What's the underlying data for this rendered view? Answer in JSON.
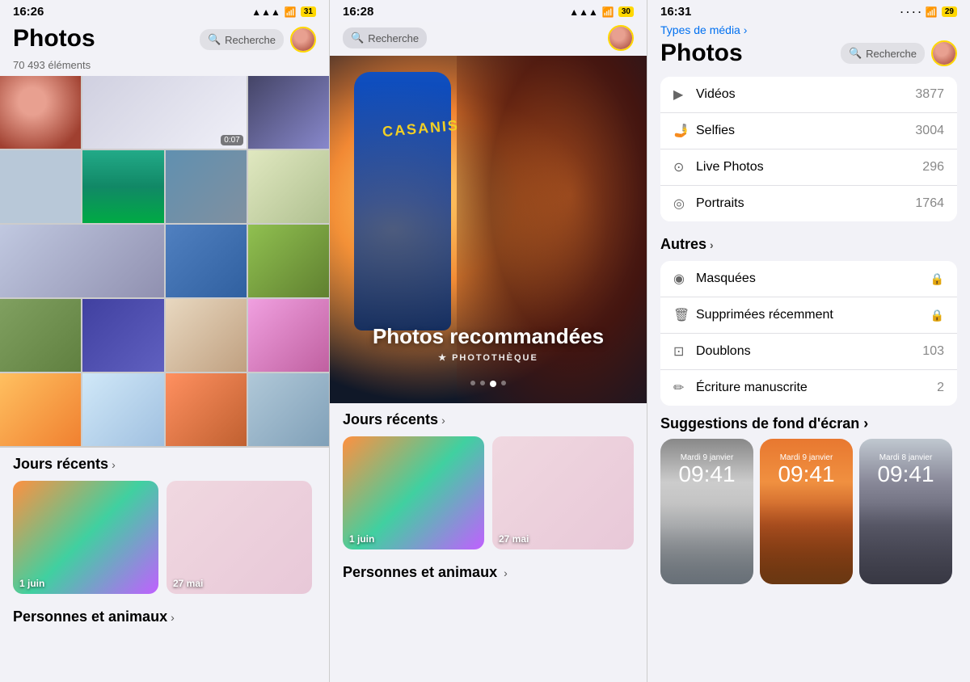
{
  "panel1": {
    "statusBar": {
      "time": "16:26",
      "signal": "▲▲▲",
      "wifi": "wifi",
      "batteryLabel": "31"
    },
    "header": {
      "title": "Photos",
      "searchLabel": "Recherche"
    },
    "subtitle": "70 493 éléments",
    "videoBadge": "0:07",
    "sectionsRecent": "Jours récents",
    "chevron": "›",
    "dayCards": [
      {
        "label": "1 juin"
      },
      {
        "label": "27 mai"
      }
    ],
    "personsSection": "Personnes et animaux"
  },
  "panel2": {
    "statusBar": {
      "time": "16:28",
      "batteryLabel": "30"
    },
    "header": {
      "searchLabel": "Recherche"
    },
    "featured": {
      "title": "Photos recommandées",
      "subtitle": "★ PHOTOTHÈQUE"
    },
    "dots": [
      "",
      "",
      "active",
      ""
    ],
    "sectionsRecent": "Jours récents",
    "chevron": "›",
    "dayCards": [
      {
        "label": "1 juin"
      },
      {
        "label": "27 mai"
      }
    ],
    "personsSection": "Personnes et animaux"
  },
  "panel3": {
    "statusBar": {
      "time": "16:31",
      "batteryLabel": "29"
    },
    "breadcrumb": "Types de média ›",
    "header": {
      "title": "Photos",
      "searchLabel": "Recherche"
    },
    "mediaTypes": {
      "title": "",
      "items": [
        {
          "icon": "▶",
          "label": "Vidéos",
          "count": "3877"
        },
        {
          "icon": "□",
          "label": "Selfies",
          "count": "3004"
        },
        {
          "icon": "⊙",
          "label": "Live Photos",
          "count": "296"
        },
        {
          "icon": "◎",
          "label": "Portraits",
          "count": "1764"
        }
      ]
    },
    "autres": {
      "title": "Autres",
      "items": [
        {
          "icon": "◉",
          "label": "Masquées",
          "count": "",
          "lock": "🔒"
        },
        {
          "icon": "🗑",
          "label": "Supprimées récemment",
          "count": "",
          "lock": "🔒"
        },
        {
          "icon": "⊡",
          "label": "Doublons",
          "count": "103"
        },
        {
          "icon": "✏",
          "label": "Écriture manuscrite",
          "count": "2"
        }
      ]
    },
    "wallpaperSection": "Suggestions de fond d'écran ›",
    "wallpapers": [
      {
        "date": "Mardi 9 janvier",
        "time": "09:41"
      },
      {
        "date": "Mardi 9 janvier",
        "time": "09:41"
      },
      {
        "date": "Mardi 8 janvier",
        "time": "09:41"
      }
    ]
  }
}
